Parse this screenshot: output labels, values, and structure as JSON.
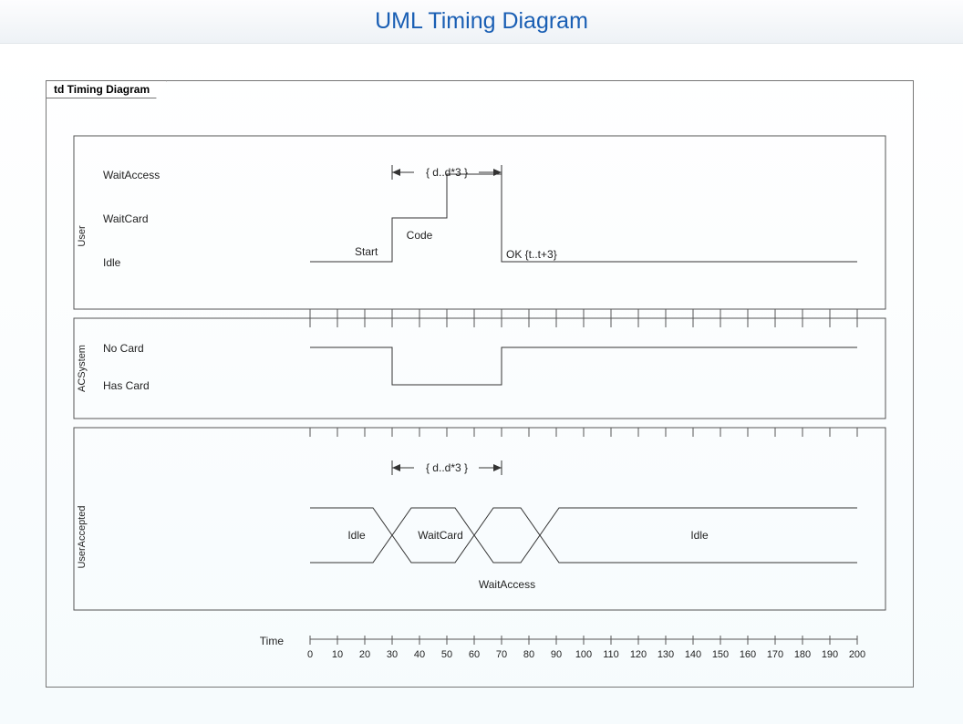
{
  "header": {
    "title": "UML Timing Diagram"
  },
  "frame_tab": "td Timing Diagram",
  "time_label": "Time",
  "time_axis": {
    "start": 0,
    "end": 200,
    "step": 10
  },
  "lanes": [
    {
      "name": "User",
      "states": [
        "WaitAccess",
        "WaitCard",
        "Idle"
      ],
      "events": {
        "start": "Start",
        "code": "Code",
        "ok": "OK {t..t+3}"
      },
      "constraint": "{ d..d*3 }"
    },
    {
      "name": "ACSystem",
      "states": [
        "No Card",
        "Has Card"
      ]
    },
    {
      "name": "UserAccepted",
      "segments": {
        "idle1": "Idle",
        "waitcard": "WaitCard",
        "waitaccess": "WaitAccess",
        "idle2": "Idle"
      },
      "constraint": "{ d..d*3 }"
    }
  ],
  "chart_data": {
    "type": "timing",
    "time_axis": {
      "min": 0,
      "max": 200,
      "unit": ""
    },
    "lifelines": [
      {
        "name": "User",
        "kind": "state-timeline",
        "states_order": [
          "Idle",
          "WaitCard",
          "WaitAccess"
        ],
        "segments": [
          {
            "state": "Idle",
            "from": 0,
            "to": 30,
            "label": "Start"
          },
          {
            "state": "WaitCard",
            "from": 30,
            "to": 50,
            "label": "Code"
          },
          {
            "state": "WaitAccess",
            "from": 50,
            "to": 70
          },
          {
            "state": "Idle",
            "from": 70,
            "to": 200,
            "label": "OK {t..t+3}"
          }
        ],
        "duration_constraint": {
          "from": 30,
          "to": 70,
          "text": "{ d..d*3 }"
        }
      },
      {
        "name": "ACSystem",
        "kind": "state-timeline",
        "states_order": [
          "Has Card",
          "No Card"
        ],
        "segments": [
          {
            "state": "No Card",
            "from": 0,
            "to": 30
          },
          {
            "state": "Has Card",
            "from": 30,
            "to": 70
          },
          {
            "state": "No Card",
            "from": 70,
            "to": 200
          }
        ]
      },
      {
        "name": "UserAccepted",
        "kind": "value-timeline",
        "segments": [
          {
            "value": "Idle",
            "from": 0,
            "to": 25
          },
          {
            "value": "WaitCard",
            "from": 30,
            "to": 55
          },
          {
            "value": "WaitAccess",
            "from": 60,
            "to": 75
          },
          {
            "value": "Idle",
            "from": 80,
            "to": 200
          }
        ],
        "duration_constraint": {
          "from": 30,
          "to": 70,
          "text": "{ d..d*3 }"
        }
      }
    ]
  }
}
